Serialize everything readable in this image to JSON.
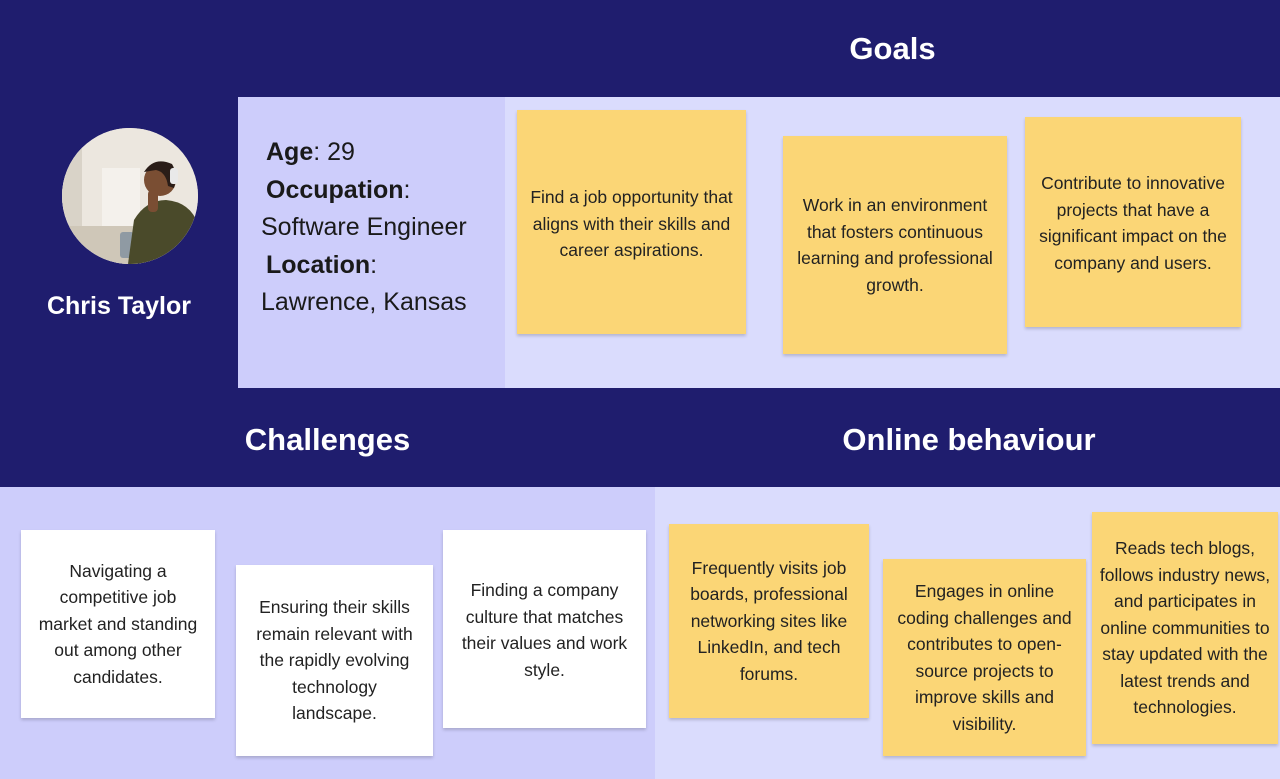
{
  "persona": {
    "name": "Chris Taylor",
    "age_label": "Age",
    "age_value": "29",
    "occupation_label": "Occupation",
    "occupation_value": "Software Engineer",
    "location_label": "Location",
    "location_value": "Lawrence, Kansas"
  },
  "goals": {
    "title": "Goals",
    "notes": [
      "Find a job opportunity that aligns with their skills and career aspirations.",
      "Work in an environment that fosters continuous learning and professional growth.",
      "Contribute to innovative projects that have a significant impact on the company and users."
    ]
  },
  "challenges": {
    "title": "Challenges",
    "notes": [
      "Navigating a competitive job market and standing out among other candidates.",
      "Ensuring their skills remain relevant with the rapidly evolving technology landscape.",
      "Finding a company culture that matches their values and work style."
    ]
  },
  "online_behaviour": {
    "title": "Online behaviour",
    "notes": [
      "Frequently visits job boards, professional networking sites like LinkedIn, and tech forums.",
      "Engages in online coding challenges and contributes to open-source projects to improve skills and visibility.",
      "Reads tech blogs, follows industry news, and participates in online communities to stay updated with the latest trends and technologies."
    ]
  },
  "colors": {
    "header_navy": "#1f1d6e",
    "panel_lavender": "#cdcdfb",
    "panel_light": "#dadcfd",
    "sticky_yellow": "#fbd676",
    "sticky_white": "#ffffff"
  }
}
